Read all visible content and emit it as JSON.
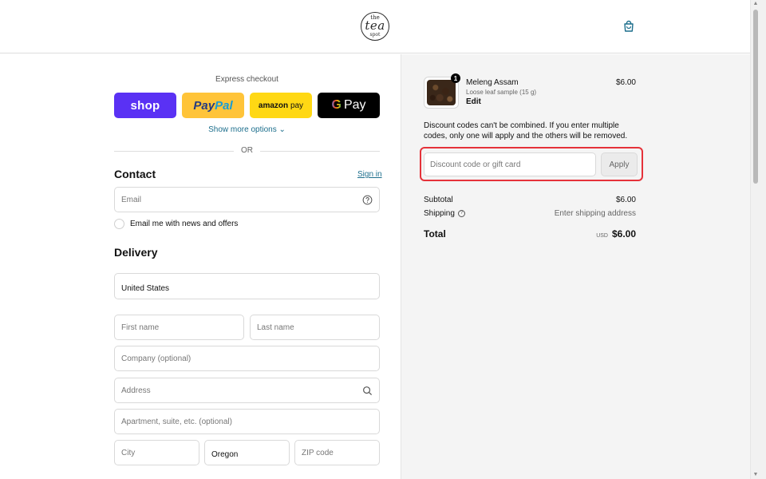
{
  "header": {
    "logo": {
      "line1": "the",
      "line2": "tea",
      "line3": "spot"
    },
    "cart_icon": "shopping-bag-icon"
  },
  "checkout": {
    "express_title": "Express checkout",
    "buttons": {
      "shop": "shop",
      "paypal_a": "Pay",
      "paypal_b": "Pal",
      "amazon_a": "amazon",
      "amazon_b": "pay",
      "gpay_g": "G",
      "gpay_text": "Pay"
    },
    "show_more": "Show more options ⌄",
    "or": "OR"
  },
  "contact": {
    "title": "Contact",
    "sign_in": "Sign in",
    "email_placeholder": "Email",
    "newsletter_label": "Email me with news and offers"
  },
  "delivery": {
    "title": "Delivery",
    "country": "United States",
    "first_name": "First name",
    "last_name": "Last name",
    "company": "Company (optional)",
    "address": "Address",
    "apartment": "Apartment, suite, etc. (optional)",
    "city": "City",
    "state": "Oregon",
    "zip": "ZIP code"
  },
  "order": {
    "quantity": "1",
    "product_name": "Meleng Assam",
    "variant": "Loose leaf sample (15 g)",
    "edit": "Edit",
    "price": "$6.00",
    "discount_note": "Discount codes can't be combined. If you enter multiple codes, only one will apply and the others will be removed.",
    "discount_placeholder": "Discount code or gift card",
    "apply": "Apply",
    "subtotal_label": "Subtotal",
    "subtotal_value": "$6.00",
    "shipping_label": "Shipping",
    "shipping_value": "Enter shipping address",
    "total_label": "Total",
    "currency": "USD",
    "total_value": "$6.00"
  },
  "colors": {
    "shop": "#5a31f4",
    "paypal": "#ffc439",
    "amazon": "#ffd814",
    "gpay": "#000000",
    "link": "#1c6e8c",
    "highlight": "#e5323a"
  }
}
